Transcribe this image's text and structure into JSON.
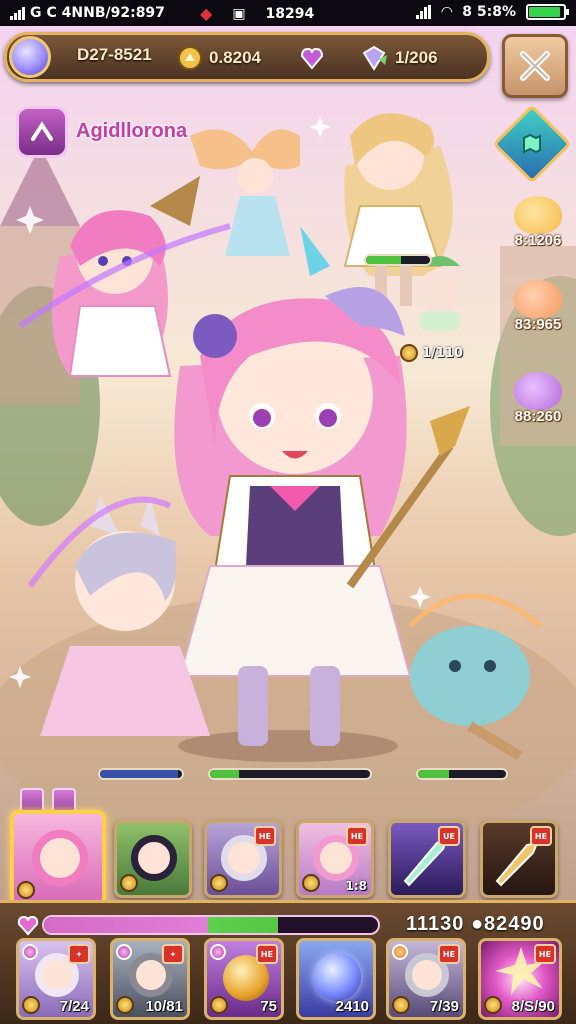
{
  "status_bar": {
    "left_text": "G",
    "carrier": "C 4NNB/92:897",
    "center_text": "18294",
    "right_text": "8 5:8%",
    "battery_level": 0.9
  },
  "resources": {
    "item_1": "D27-8521",
    "item_2": "0.8204",
    "item_3": "1/206"
  },
  "hero": {
    "name": "Agidllorona"
  },
  "side_rewards": [
    {
      "value": "8:1206",
      "icon": "yellow-slime-icon",
      "color": "#f7b84a"
    },
    {
      "value": "83:965",
      "icon": "orange-slime-icon",
      "color": "#f79a5c"
    },
    {
      "value": "88:260",
      "icon": "purple-slime-icon",
      "color": "#b46ad8"
    }
  ],
  "scene": {
    "level_tag": "1/110",
    "ally_hp_fraction": 0.55
  },
  "battle_bars": [
    {
      "name": "mana-bar",
      "fraction": 0.95,
      "color": "#3a4fa8"
    },
    {
      "name": "hero-hp-bar",
      "fraction": 0.18,
      "color": "#4ec23c"
    },
    {
      "name": "enemy-hp-bar",
      "fraction": 0.35,
      "color": "#4ec23c"
    }
  ],
  "team_slots": [
    {
      "name": "pink-mage",
      "selected": true,
      "badge": "",
      "num": ""
    },
    {
      "name": "dark-hair-hero",
      "selected": false,
      "badge": "",
      "num": ""
    },
    {
      "name": "silver-hair-hero",
      "selected": false,
      "badge": "НЕ",
      "num": ""
    },
    {
      "name": "pink-hair-hero",
      "selected": false,
      "badge": "НЕ",
      "num": "1:8"
    },
    {
      "name": "crystal-weapon",
      "selected": false,
      "badge": "UE",
      "num": ""
    },
    {
      "name": "dark-crystal",
      "selected": false,
      "badge": "НЕ",
      "num": ""
    }
  ],
  "bottom_panel": {
    "xp_value": "11130 ●82490",
    "xp_fraction": 0.7,
    "cards": [
      {
        "name": "white-hair-hero",
        "num": "7/24"
      },
      {
        "name": "gray-hair-hero",
        "num": "10/81"
      },
      {
        "name": "gold-orb",
        "num": "75"
      },
      {
        "name": "blue-orb",
        "num": "2410"
      },
      {
        "name": "silver-knight",
        "num": "7/39"
      },
      {
        "name": "pink-burst",
        "num": "8/S/90"
      }
    ]
  }
}
